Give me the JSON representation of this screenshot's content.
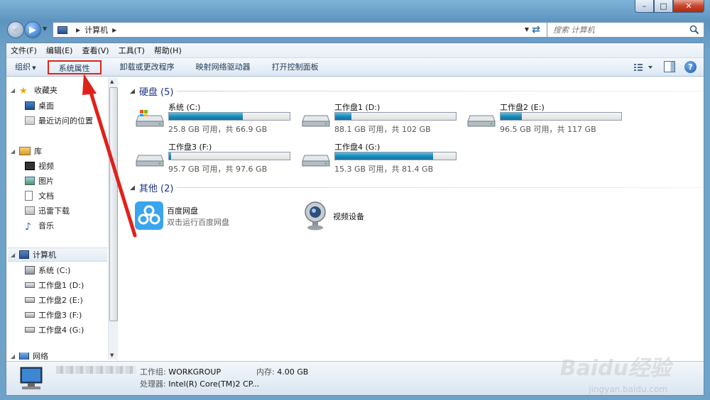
{
  "window": {
    "caption_buttons": [
      "–",
      "□",
      "✕"
    ]
  },
  "address": {
    "path": [
      "计算机"
    ],
    "search_placeholder": "搜索 计算机"
  },
  "menubar": [
    "文件(F)",
    "编辑(E)",
    "查看(V)",
    "工具(T)",
    "帮助(H)"
  ],
  "commands": {
    "organize": "组织",
    "system_properties": "系统属性",
    "uninstall": "卸载或更改程序",
    "map_drive": "映射网络驱动器",
    "control_panel": "打开控制面板"
  },
  "nav": {
    "favorites": "收藏夹",
    "desktop": "桌面",
    "recent": "最近访问的位置",
    "libraries": "库",
    "videos": "视频",
    "pictures": "图片",
    "documents": "文档",
    "thunder": "迅雷下载",
    "music": "音乐",
    "computer": "计算机",
    "drives": [
      "系统 (C:)",
      "工作盘1 (D:)",
      "工作盘2 (E:)",
      "工作盘3 (F:)",
      "工作盘4 (G:)"
    ],
    "network": "网络"
  },
  "groups": {
    "hdd_title": "硬盘 (5)",
    "other_title": "其他 (2)"
  },
  "drives": [
    {
      "name": "系统 (C:)",
      "info": "25.8 GB 可用，共 66.9 GB",
      "used": 0.614
    },
    {
      "name": "工作盘1 (D:)",
      "info": "88.1 GB 可用，共 102 GB",
      "used": 0.136
    },
    {
      "name": "工作盘2 (E:)",
      "info": "96.5 GB 可用，共 117 GB",
      "used": 0.175
    },
    {
      "name": "工作盘3 (F:)",
      "info": "95.7 GB 可用，共 97.6 GB",
      "used": 0.019
    },
    {
      "name": "工作盘4 (G:)",
      "info": "15.3 GB 可用，共 81.4 GB",
      "used": 0.812
    }
  ],
  "others": [
    {
      "name": "百度网盘",
      "desc": "双击运行百度网盘"
    },
    {
      "name": "视频设备",
      "desc": ""
    }
  ],
  "details": {
    "workgroup_label": "工作组:",
    "workgroup_value": "WORKGROUP",
    "memory_label": "内存:",
    "memory_value": "4.00 GB",
    "cpu_label": "处理器:",
    "cpu_value": "Intel(R) Core(TM)2 CP..."
  },
  "watermark": {
    "logo": "Baidu经验",
    "url": "jingyan.baidu.com"
  },
  "colors": {
    "annotation": "#e0211a",
    "drive_fill": "#1e8ab9",
    "group_title": "#1e3287"
  }
}
